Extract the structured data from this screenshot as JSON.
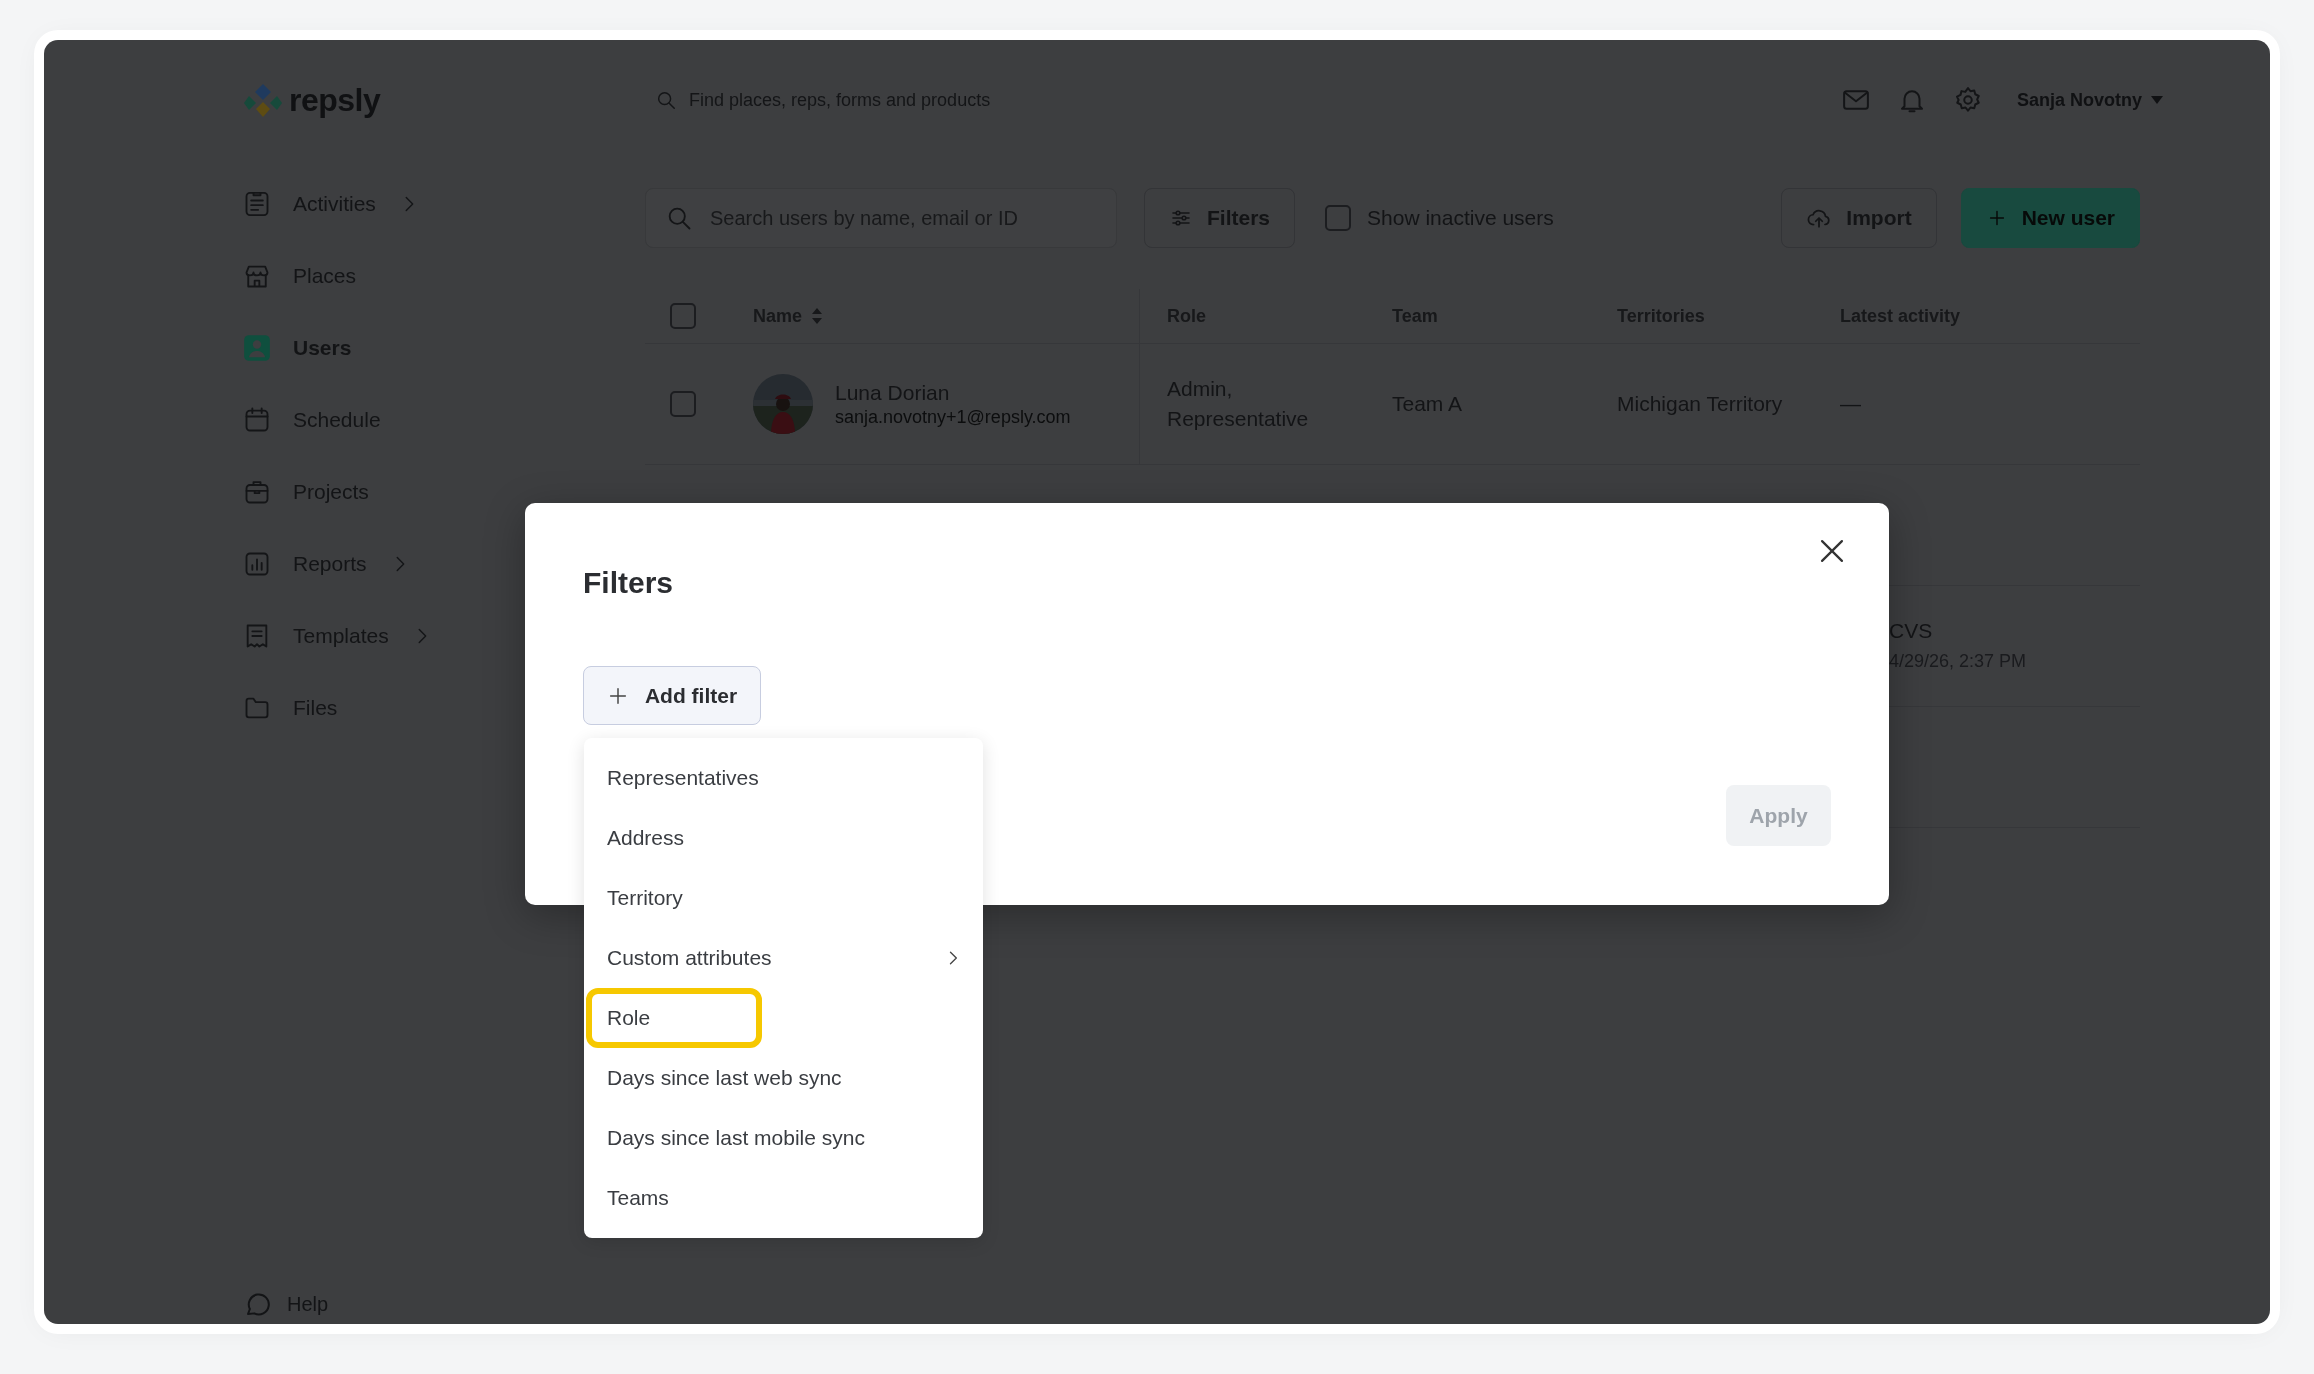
{
  "header": {
    "logo": "repsly",
    "search_placeholder": "Find places, reps, forms and products",
    "user_name": "Sanja Novotny"
  },
  "sidebar": {
    "items": [
      {
        "label": "Activities",
        "kind": "activities",
        "selected": false,
        "has_submenu": true
      },
      {
        "label": "Places",
        "kind": "places",
        "selected": false,
        "has_submenu": false
      },
      {
        "label": "Users",
        "kind": "users",
        "selected": true,
        "has_submenu": false
      },
      {
        "label": "Schedule",
        "kind": "schedule",
        "selected": false,
        "has_submenu": false
      },
      {
        "label": "Projects",
        "kind": "projects",
        "selected": false,
        "has_submenu": false
      },
      {
        "label": "Reports",
        "kind": "reports",
        "selected": false,
        "has_submenu": true
      },
      {
        "label": "Templates",
        "kind": "templates",
        "selected": false,
        "has_submenu": true
      },
      {
        "label": "Files",
        "kind": "files",
        "selected": false,
        "has_submenu": false
      }
    ],
    "help": "Help"
  },
  "toolbar": {
    "search": {
      "placeholder": "Search users by name, email or ID"
    },
    "filters_button": "Filters",
    "show_inactive": {
      "label": "Show inactive users",
      "checked": false
    },
    "import_button": "Import",
    "new_user_button": "New user"
  },
  "table": {
    "select_all_checked": false,
    "columns": [
      "Name",
      "Role",
      "Team",
      "Territories",
      "Latest activity"
    ],
    "rows": [
      {
        "kind": "full",
        "checked": false,
        "name": "Luna Dorian",
        "email": "sanja.novotny+1@repsly.com",
        "role": "Admin, Representative",
        "team": "Team A",
        "territories": "Michigan Territory",
        "latest_activity": "—"
      },
      {
        "kind": "covered"
      },
      {
        "kind": "partial",
        "latest_activity": "CVS",
        "latest_activity_time": "4/29/26, 2:37 PM"
      },
      {
        "kind": "covered"
      }
    ]
  },
  "modal": {
    "title": "Filters",
    "add_filter_button": "Add filter",
    "apply_button": {
      "label": "Apply",
      "disabled": true
    },
    "filter_menu": {
      "items": [
        {
          "label": "Representatives",
          "has_submenu": false,
          "highlighted": false
        },
        {
          "label": "Address",
          "has_submenu": false,
          "highlighted": false
        },
        {
          "label": "Territory",
          "has_submenu": false,
          "highlighted": false
        },
        {
          "label": "Custom attributes",
          "has_submenu": true,
          "highlighted": false
        },
        {
          "label": "Role",
          "has_submenu": false,
          "highlighted": true
        },
        {
          "label": "Days since last web sync",
          "has_submenu": false,
          "highlighted": false
        },
        {
          "label": "Days since last mobile sync",
          "has_submenu": false,
          "highlighted": false
        },
        {
          "label": "Teams",
          "has_submenu": false,
          "highlighted": false
        }
      ]
    }
  }
}
